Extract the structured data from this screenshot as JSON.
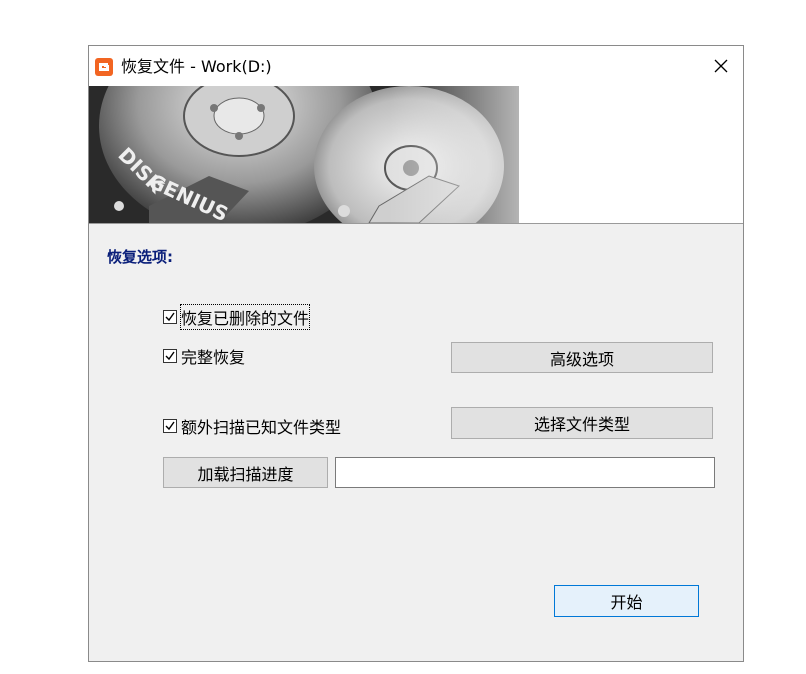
{
  "window": {
    "title": "恢复文件 - Work(D:)",
    "app_icon": "disk-genius-logo-icon",
    "close_icon": "close-icon",
    "banner_text": "DISK GENIUS"
  },
  "options": {
    "section_label": "恢复选项:",
    "recover_deleted": {
      "label": "恢复已删除的文件",
      "checked": true
    },
    "full_recovery": {
      "label": "完整恢复",
      "checked": true
    },
    "scan_known_types": {
      "label": "额外扫描已知文件类型",
      "checked": true
    }
  },
  "buttons": {
    "advanced": "高级选项",
    "select_types": "选择文件类型",
    "load_progress": "加载扫描进度",
    "start": "开始"
  },
  "progress_path": {
    "value": ""
  },
  "colors": {
    "accent": "#0078d7",
    "section_label": "#0a1f7a",
    "dialog_bg": "#f0f0f0"
  }
}
